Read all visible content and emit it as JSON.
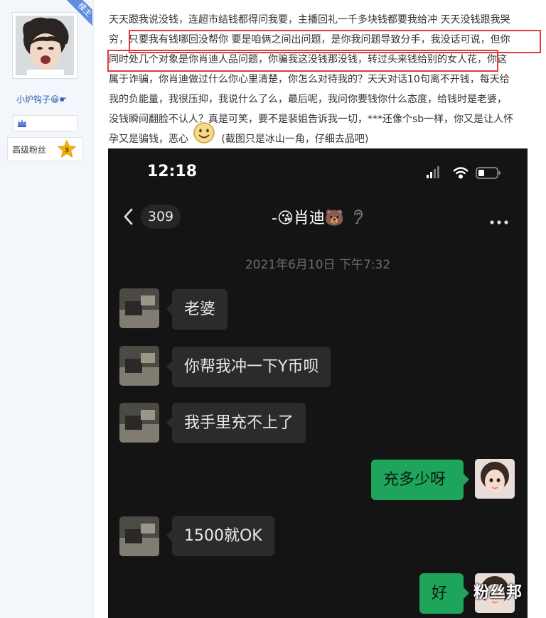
{
  "author": {
    "role_badge": "楼主",
    "username": "小炉钩子😀☛",
    "fan_level_label": "高级粉丝",
    "fan_level_number": "3"
  },
  "post": {
    "lines": [
      "天天跟我说没钱，连超市结钱都得问我要，主播回礼一千多块钱都要我给冲 天天没钱跟我哭",
      "穷，只要我有钱哪回没帮你 要是咱俩之间出问题，是你我问题导致分手，我没话可说，但你",
      "同时处几个对象是你肖迪人品问题，你骗我这没钱那没钱，转过头来钱给别的女人花，你这",
      "属于诈骗，你肖迪做过什么你心里清楚，你怎么对待我的？天天对话10句离不开钱，每天给",
      "我的负能量，我很压抑，我说什么了么，最后呢，我问你要钱你什么态度，给钱时是老婆，",
      "没钱瞬间翻脸不认人？真是可笑，要不是裴姐告诉我一切，***还像个sb一样，你又是让人怀",
      "孕又是骗钱，恶心"
    ],
    "after_emoji": " (截图只是冰山一角，仔细去品吧)"
  },
  "screenshot": {
    "status_time": "12:18",
    "back_count": "309",
    "chat_title": "-😘肖迪🐻",
    "date": "2021年6月10日 下午7:32",
    "messages": [
      {
        "from": "other",
        "text": "老婆"
      },
      {
        "from": "other",
        "text": "你帮我冲一下Y币呗"
      },
      {
        "from": "other",
        "text": "我手里充不上了"
      },
      {
        "from": "me",
        "text": "充多少呀"
      },
      {
        "from": "other",
        "text": "1500就OK"
      },
      {
        "from": "me",
        "text": "好"
      }
    ]
  },
  "watermark": "粉丝邦",
  "colors": {
    "highlight_box": "#e03a3a",
    "sent_bubble": "#1fa55b",
    "received_bubble": "#2b2b2b",
    "chat_bg": "#141414",
    "username_link": "#2d64b3"
  }
}
